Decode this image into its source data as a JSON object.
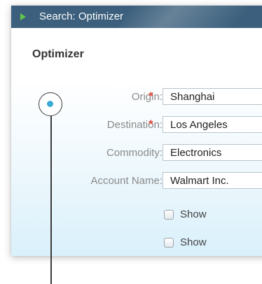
{
  "window": {
    "title": "Search: Optimizer"
  },
  "form": {
    "heading": "Optimizer",
    "fields": [
      {
        "label": "Origin:",
        "required": true,
        "value": "Shanghai"
      },
      {
        "label": "Destination:",
        "required": true,
        "value": "Los Angeles"
      },
      {
        "label": "Commodity:",
        "required": false,
        "value": "Electronics"
      },
      {
        "label": "Account Name:",
        "required": false,
        "value": "Walmart Inc."
      }
    ],
    "required_marker": "*",
    "checkboxes": [
      {
        "label": "Show",
        "checked": false
      },
      {
        "label": "Show",
        "checked": false
      }
    ]
  },
  "colors": {
    "titlebar": "#3b5f7c",
    "accent_arrow": "#61c64a",
    "required": "#e2463a",
    "marker_dot": "#3aa9d6"
  },
  "icons": {
    "title": "play-arrow-icon",
    "marker": "callout-marker-icon"
  }
}
